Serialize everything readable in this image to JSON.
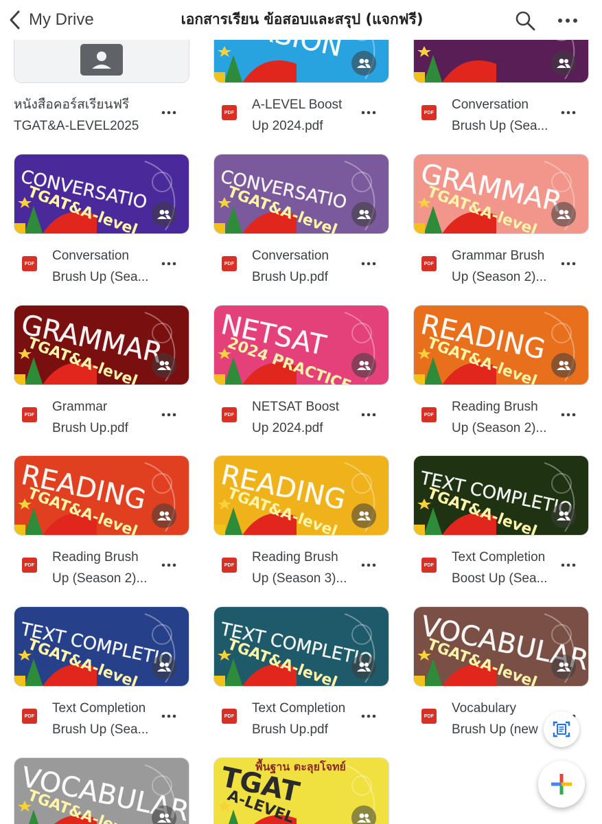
{
  "header": {
    "back_label": "My Drive",
    "title": "เอกสารเรียน ข้อสอบและสรุป (แจกฟรี)",
    "search_icon": "search-icon",
    "more_icon": "more-horizontal-icon"
  },
  "colors": {
    "pdf_red": "#d93025",
    "icon_gray": "#5f6368",
    "accent_blue": "#1a73e8"
  },
  "files": [
    {
      "type": "folder",
      "name_line1": "หนังสือคอร์สเรียนฟรี",
      "name_line2": "TGAT&A-LEVEL2025",
      "thumb_text": "",
      "thumb_sub": "",
      "thumb_color": "#f1f3f4"
    },
    {
      "type": "pdf",
      "name_line1": "A-LEVEL Boost",
      "name_line2": "Up 2024.pdf",
      "thumb_text": "VERSION",
      "thumb_sub": "",
      "thumb_color": "#29a3e0"
    },
    {
      "type": "pdf",
      "name_line1": "Conversation",
      "name_line2": "Brush Up (Sea...",
      "thumb_text": "",
      "thumb_sub": "",
      "thumb_color": "#5a1e57"
    },
    {
      "type": "pdf",
      "name_line1": "Conversation",
      "name_line2": "Brush Up (Sea...",
      "thumb_text": "CONVERSATIO",
      "thumb_sub": "TGAT&A-level",
      "thumb_color": "#4a2a9a"
    },
    {
      "type": "pdf",
      "name_line1": "Conversation",
      "name_line2": "Brush Up.pdf",
      "thumb_text": "CONVERSATIO",
      "thumb_sub": "TGAT&A-level",
      "thumb_color": "#7a5a9c"
    },
    {
      "type": "pdf",
      "name_line1": "Grammar Brush",
      "name_line2": "Up (Season 2)...",
      "thumb_text": "GRAMMAR",
      "thumb_sub": "TGAT&A-level",
      "thumb_color": "#f2958a"
    },
    {
      "type": "pdf",
      "name_line1": "Grammar",
      "name_line2": "Brush Up.pdf",
      "thumb_text": "GRAMMAR",
      "thumb_sub": "TGAT&A-level",
      "thumb_color": "#7a0f0f"
    },
    {
      "type": "pdf",
      "name_line1": "NETSAT Boost",
      "name_line2": "Up 2024.pdf",
      "thumb_text": "NETSAT",
      "thumb_sub": "2024 PRACTICE",
      "thumb_color": "#e4407a"
    },
    {
      "type": "pdf",
      "name_line1": "Reading Brush",
      "name_line2": "Up (Season 2)...",
      "thumb_text": "READING",
      "thumb_sub": "TGAT&A-level",
      "thumb_color": "#e86f1c"
    },
    {
      "type": "pdf",
      "name_line1": "Reading Brush",
      "name_line2": "Up (Season 2)...",
      "thumb_text": "READING",
      "thumb_sub": "TGAT&A-level",
      "thumb_color": "#e0401f"
    },
    {
      "type": "pdf",
      "name_line1": "Reading Brush",
      "name_line2": "Up (Season 3)...",
      "thumb_text": "READING",
      "thumb_sub": "TGAT&A-level",
      "thumb_color": "#f0b21a"
    },
    {
      "type": "pdf",
      "name_line1": "Text Completion",
      "name_line2": "Boost Up (Sea...",
      "thumb_text": "TEXT COMPLETIO",
      "thumb_sub": "TGAT&A-level",
      "thumb_color": "#1f3212"
    },
    {
      "type": "pdf",
      "name_line1": "Text Completion",
      "name_line2": "Brush Up (Sea...",
      "thumb_text": "TEXT COMPLETIO",
      "thumb_sub": "TGAT&A-level",
      "thumb_color": "#27408a"
    },
    {
      "type": "pdf",
      "name_line1": "Text Completion",
      "name_line2": "Brush Up.pdf",
      "thumb_text": "TEXT COMPLETIO",
      "thumb_sub": "TGAT&A-level",
      "thumb_color": "#1f5a6a"
    },
    {
      "type": "pdf",
      "name_line1": "Vocabulary",
      "name_line2": "Brush Up (new",
      "thumb_text": "VOCABULAR",
      "thumb_sub": "TGAT&A-level",
      "thumb_color": "#7a4f45"
    },
    {
      "type": "pdf",
      "name_line1": "",
      "name_line2": "",
      "thumb_text": "VOCABULAR",
      "thumb_sub": "TGAT&A-level",
      "thumb_color": "#9a9a9a"
    },
    {
      "type": "pdf",
      "name_line1": "",
      "name_line2": "",
      "thumb_text": "TGAT",
      "thumb_sub": "A-LEVEL",
      "thumb_top_text": "พื้นฐาน ตะลุยโจทย์",
      "thumb_color": "#f0e040"
    }
  ]
}
